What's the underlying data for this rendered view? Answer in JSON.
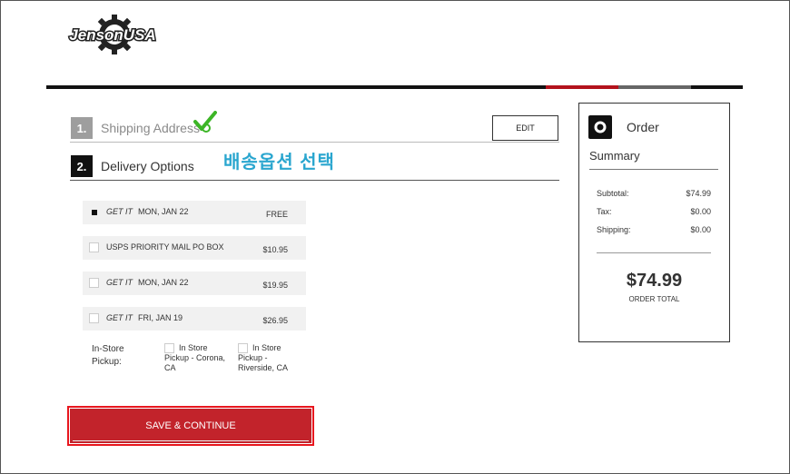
{
  "logo": {
    "text": "JensonUSA"
  },
  "steps": [
    {
      "number": "1.",
      "label": "Shipping Address",
      "edit_label": "EDIT"
    },
    {
      "number": "2.",
      "label": "Delivery Options"
    }
  ],
  "annotation": "배송옵션 선택",
  "delivery_options": [
    {
      "prefix": "GET IT",
      "name": "MON, JAN 22",
      "price": "FREE",
      "checked": true
    },
    {
      "prefix": "",
      "name": "USPS PRIORITY MAIL PO BOX",
      "price": "$10.95",
      "checked": false
    },
    {
      "prefix": "GET IT",
      "name": "MON, JAN 22",
      "price": "$19.95",
      "checked": false
    },
    {
      "prefix": "GET IT",
      "name": "FRI, JAN 19",
      "price": "$26.95",
      "checked": false
    }
  ],
  "in_store": {
    "label_line1": "In-Store",
    "label_line2": "Pickup:",
    "options": [
      {
        "line1": "In Store",
        "line2": "Pickup - Corona,",
        "line3": "CA"
      },
      {
        "line1": "In Store",
        "line2": "Pickup -",
        "line3": "Riverside, CA"
      }
    ]
  },
  "save_button": "SAVE & CONTINUE",
  "summary": {
    "title_line1": "Order",
    "title_line2": "Summary",
    "rows": [
      {
        "label": "Subtotal:",
        "value": "$74.99"
      },
      {
        "label": "Tax:",
        "value": "$0.00"
      },
      {
        "label": "Shipping:",
        "value": "$0.00"
      }
    ],
    "total": "$74.99",
    "total_label": "ORDER TOTAL"
  },
  "colors": {
    "brand_red": "#c2232b",
    "annotation": "#2aa6cf",
    "check_green": "#3cb526"
  }
}
